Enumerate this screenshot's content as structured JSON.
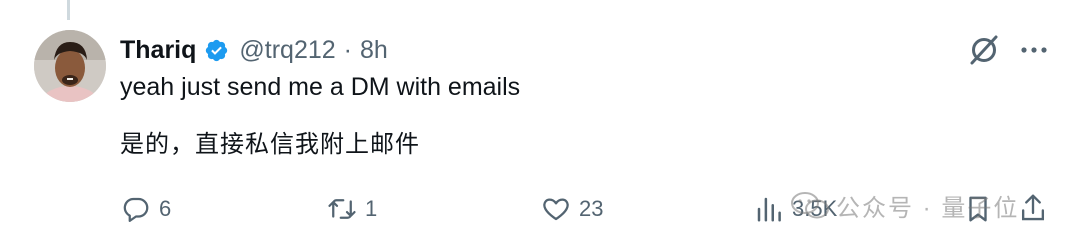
{
  "tweet": {
    "author_name": "Thariq",
    "handle": "@trq212",
    "separator": "·",
    "time": "8h",
    "text": "yeah just send me a DM with emails",
    "translation": "是的，直接私信我附上邮件"
  },
  "actions": {
    "replies": "6",
    "reposts": "1",
    "likes": "23",
    "views": "3.5K"
  },
  "watermark": {
    "text": "公众号 · 量子位"
  },
  "icons": {
    "verified": "verified-badge-icon",
    "grok": "grok-icon",
    "more": "more-icon",
    "reply": "reply-icon",
    "repost": "repost-icon",
    "like": "heart-icon",
    "views": "views-icon",
    "bookmark": "bookmark-icon",
    "share": "share-icon"
  },
  "colors": {
    "text": "#0f1419",
    "secondary": "#536471",
    "verified": "#1d9bf0",
    "thread_line": "#cfd9de"
  }
}
